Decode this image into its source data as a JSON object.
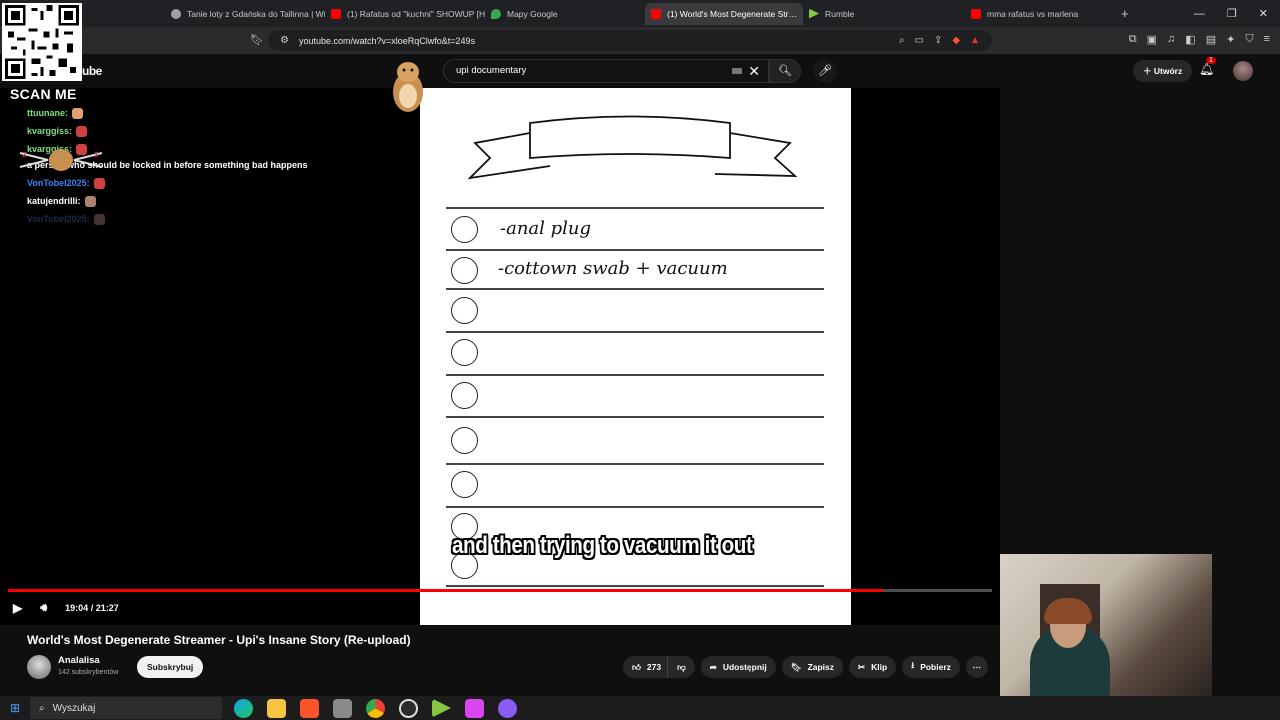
{
  "browser": {
    "tabs": [
      {
        "label": "Tanie loty z Gdańska do Tallinna | Wi…",
        "color": "#9aa0a6"
      },
      {
        "label": "(1) Rafatus od \"kuchni\" SHOWUP [H…",
        "color": "#ff0000"
      },
      {
        "label": "Mapy Google",
        "color": "#34a853"
      },
      {
        "label": "(1) World's Most Degenerate Str…",
        "color": "#ff0000",
        "active": true
      },
      {
        "label": "Rumble",
        "color": "#85c742"
      },
      {
        "label": "mma rafatus vs marlena",
        "color": "#ff0000"
      }
    ],
    "url": "youtube.com/watch?v=xloeRqClwfo&t=249s",
    "new_tab": "+",
    "win_minimize": "—",
    "win_restore": "❐",
    "win_close": "✕"
  },
  "overlay": {
    "scan_me": "SCAN ME"
  },
  "youtube": {
    "logo_fragment": "ube",
    "search_value": "upi documentary",
    "create_label": "Utwórz",
    "notif_count": "1"
  },
  "chat": [
    {
      "user": "ttuunane:",
      "text": "",
      "color": "#7ee07e"
    },
    {
      "user": "kvarggiss:",
      "text": "",
      "color": "#7ee07e"
    },
    {
      "user": "kvarggiss:",
      "text": "",
      "color": "#7ee07e"
    },
    {
      "user": "",
      "text": "a person who should be locked in before something bad happens",
      "color": "#ffffff"
    },
    {
      "user": "VonTobel2025:",
      "text": "",
      "color": "#3b82f6"
    },
    {
      "user": "katujendrilli:",
      "text": "",
      "color": "#ffffff"
    },
    {
      "user": "VonTobel2025:",
      "text": "",
      "color": "#2d4f8c"
    }
  ],
  "video": {
    "checklist": [
      "-anal plug",
      "-cottown swab + vacuum"
    ],
    "subtitle": "and then trying to vacuum it out",
    "time": "19:04 / 21:27",
    "progress": 0.8894
  },
  "meta": {
    "title": "World's Most Degenerate Streamer - Upi's Insane Story (Re-upload)",
    "channel": "Analalisa",
    "subs": "142 subskrybentów",
    "subscribe": "Subskrybuj",
    "likes": "273",
    "share": "Udostępnij",
    "save": "Zapisz",
    "clip": "Klip",
    "download": "Pobierz"
  },
  "taskbar": {
    "search": "Wyszukaj"
  }
}
